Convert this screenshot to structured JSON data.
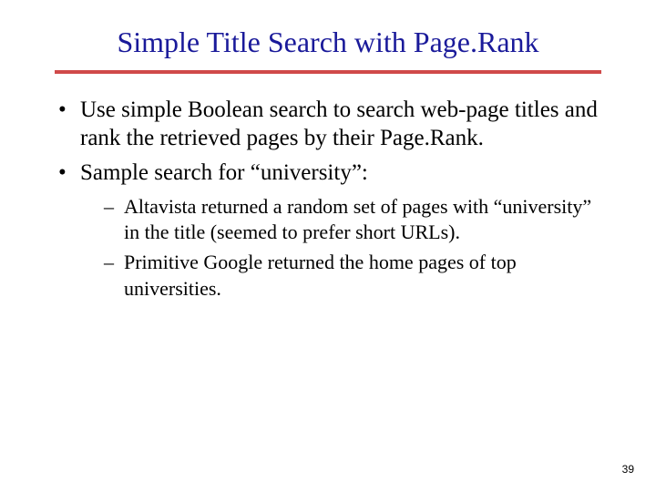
{
  "title": "Simple Title Search with Page.Rank",
  "bullets": {
    "b1": "Use simple Boolean search to search web-page titles and rank the retrieved pages by their Page.Rank.",
    "b2": "Sample search for “university”:"
  },
  "subbullets": {
    "s1": "Altavista returned a random set of pages with “university” in the title (seemed to prefer short URLs).",
    "s2": "Primitive Google returned the home pages of top universities."
  },
  "pageNumber": "39"
}
